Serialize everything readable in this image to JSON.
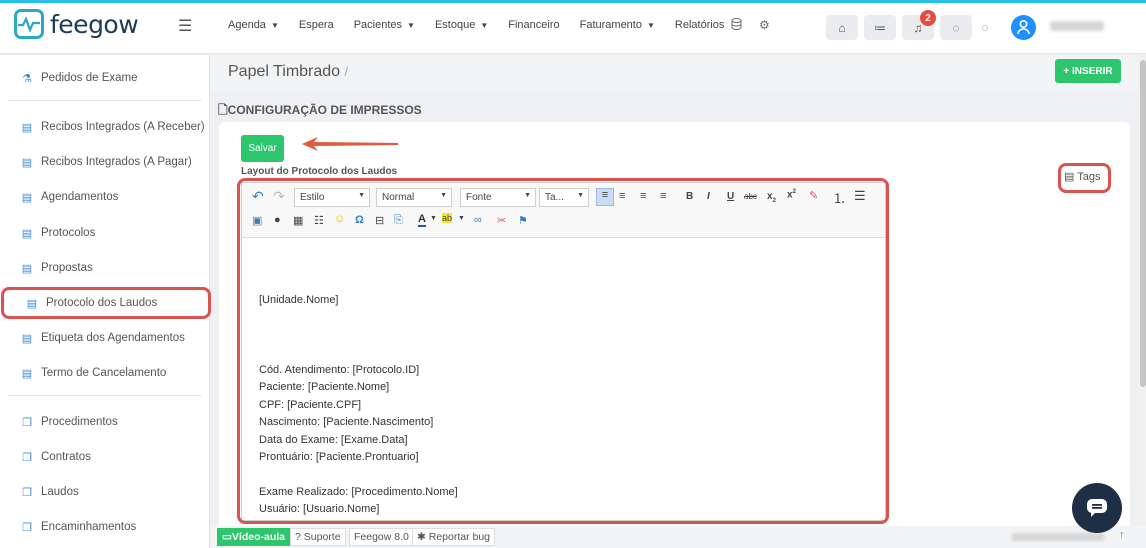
{
  "brand": {
    "name": "feegow",
    "accent": "#2aa8c8"
  },
  "nav": {
    "items": [
      {
        "label": "Agenda",
        "caret": true
      },
      {
        "label": "Espera",
        "caret": false
      },
      {
        "label": "Pacientes",
        "caret": true
      },
      {
        "label": "Estoque",
        "caret": true
      },
      {
        "label": "Financeiro",
        "caret": false
      },
      {
        "label": "Faturamento",
        "caret": true
      },
      {
        "label": "Relatórios",
        "caret": false
      }
    ],
    "notification_count": "2"
  },
  "sidebar": {
    "items": [
      {
        "label": "Pedidos de Exame",
        "icon": "flask-icon"
      },
      {
        "label": "Recibos Integrados (A Receber)",
        "icon": "file-icon"
      },
      {
        "label": "Recibos Integrados (A Pagar)",
        "icon": "file-icon"
      },
      {
        "label": "Agendamentos",
        "icon": "file-icon"
      },
      {
        "label": "Protocolos",
        "icon": "file-icon"
      },
      {
        "label": "Propostas",
        "icon": "file-icon"
      },
      {
        "label": "Protocolo dos Laudos",
        "icon": "file-icon",
        "active": true
      },
      {
        "label": "Etiqueta dos Agendamentos",
        "icon": "file-icon"
      },
      {
        "label": "Termo de Cancelamento",
        "icon": "file-icon"
      },
      {
        "label": "Procedimentos",
        "icon": "copy-icon"
      },
      {
        "label": "Contratos",
        "icon": "copy-icon"
      },
      {
        "label": "Laudos",
        "icon": "copy-icon"
      },
      {
        "label": "Encaminhamentos",
        "icon": "copy-icon"
      }
    ]
  },
  "page": {
    "title": "Papel Timbrado",
    "breadcrumb_sep": "/",
    "insert_label": "+ INSERIR",
    "section_title": "CONFIGURAÇÃO DE IMPRESSOS",
    "save_label": "Salvar",
    "layout_label": "Layout do Protocolo dos Laudos",
    "tags_label": "Tags"
  },
  "editor": {
    "combos": {
      "style": "Estilo",
      "format": "Normal",
      "font": "Fonte",
      "size": "Ta..."
    },
    "lines": [
      "",
      "[Unidade.Nome]",
      "",
      "",
      "",
      "Cód. Atendimento: [Protocolo.ID]",
      "Paciente: [Paciente.Nome]",
      "CPF: [Paciente.CPF]",
      "Nascimento: [Paciente.Nascimento]",
      "Data do Exame: [Exame.Data]",
      "Prontuário: [Paciente.Prontuario]",
      "",
      "Exame Realizado: [Procedimento.Nome]",
      "Usuário: [Usuario.Nome]"
    ]
  },
  "footer": {
    "video": "Vídeo-aula",
    "support": "Suporte",
    "version": "Feegow 8.0",
    "bug": "Reportar bug"
  }
}
